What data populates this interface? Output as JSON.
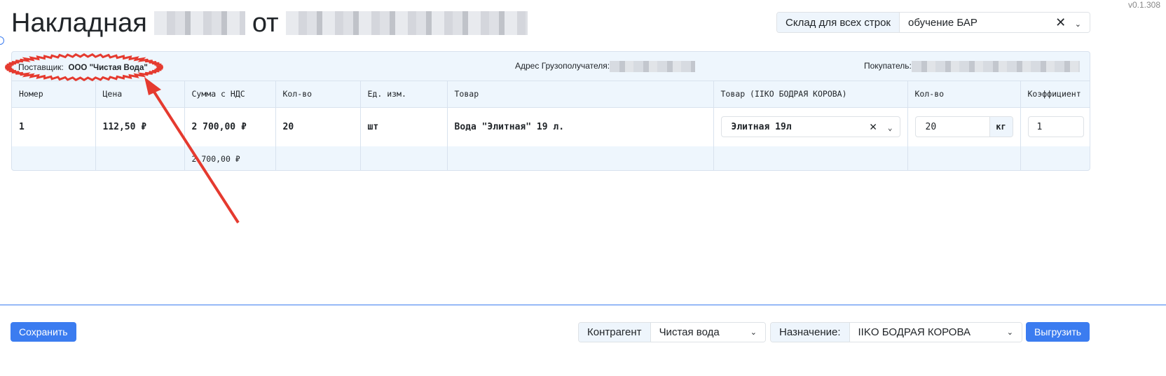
{
  "version": "v0.1.308",
  "title": {
    "prefix": "Накладная",
    "middle": "от"
  },
  "warehouse": {
    "label": "Склад для всех строк",
    "value": "обучение БАР"
  },
  "info": {
    "supplier_label": "Поставщик:",
    "supplier_value": "ООО \"Чистая Вода\"",
    "consignee_label": "Адрес Грузополучателя:",
    "buyer_label": "Покупатель:"
  },
  "columns": [
    "Номер",
    "Цена",
    "Сумма с НДС",
    "Кол-во",
    "Ед. изм.",
    "Товар",
    "Товар (IIKO БОДРАЯ КОРОВА)",
    "Кол-во",
    "Коэффициент"
  ],
  "rows": [
    {
      "num": "1",
      "price": "112,50 ₽",
      "sum": "2 700,00 ₽",
      "qty": "20",
      "unit": "шт",
      "product": "Вода \"Элитная\" 19 л.",
      "mapped": "Элитная 19л",
      "mapped_qty": "20",
      "mapped_unit": "кг",
      "coef": "1"
    }
  ],
  "total": {
    "sum": "2 700,00 ₽"
  },
  "footer": {
    "save": "Сохранить",
    "counterparty_label": "Контрагент",
    "counterparty_value": "Чистая вода",
    "dest_label": "Назначение:",
    "dest_value": "IIKO БОДРАЯ КОРОВА",
    "export": "Выгрузить"
  },
  "annotation_color": "#e53a2f",
  "accent": "#3b7cf0"
}
